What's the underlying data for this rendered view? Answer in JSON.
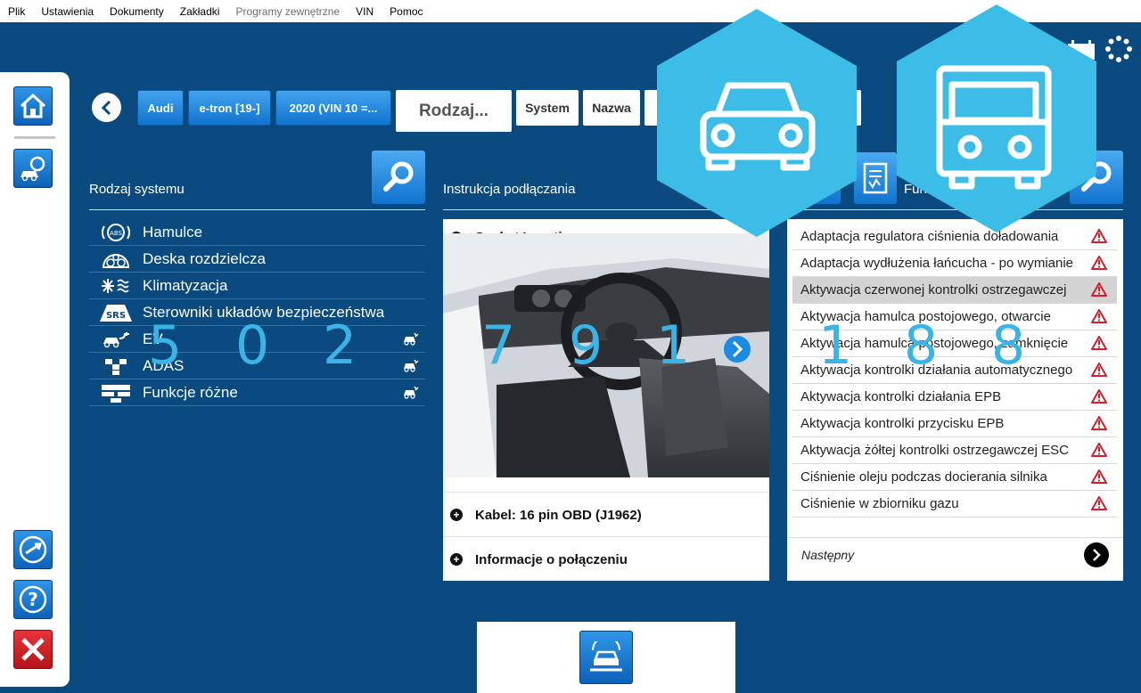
{
  "menu": [
    {
      "label": "Plik",
      "disabled": false
    },
    {
      "label": "Ustawienia",
      "disabled": false
    },
    {
      "label": "Dokumenty",
      "disabled": false
    },
    {
      "label": "Zakładki",
      "disabled": false
    },
    {
      "label": "Programy zewnętrzne",
      "disabled": true
    },
    {
      "label": "VIN",
      "disabled": false
    },
    {
      "label": "Pomoc",
      "disabled": false
    }
  ],
  "breadcrumb": {
    "brand": "Audi",
    "model": "e-tron [19-]",
    "year": "2020 (VIN 10 =...",
    "current": "Rodzaj...",
    "system": "System",
    "name": "Nazwa"
  },
  "left_panel": {
    "title": "Rodzaj systemu",
    "items": [
      {
        "label": "Hamulce",
        "icon": "abs-icon",
        "car": false
      },
      {
        "label": "Deska rozdzielcza",
        "icon": "dashboard-icon",
        "car": false
      },
      {
        "label": "Klimatyzacja",
        "icon": "climate-icon",
        "car": false
      },
      {
        "label": "Sterowniki układów bezpieczeństwa",
        "icon": "srs-icon",
        "car": false
      },
      {
        "label": "EV",
        "icon": "ev-icon",
        "car": true
      },
      {
        "label": "ADAS",
        "icon": "adas-icon",
        "car": true
      },
      {
        "label": "Funkcje różne",
        "icon": "misc-functions-icon",
        "car": true
      }
    ]
  },
  "middle_panel": {
    "title": "Instrukcja podłączania",
    "socket_location": "Socket Location",
    "cable": "Kabel: 16 pin OBD (J1962)",
    "connection_info": "Informacje o połączeniu"
  },
  "right_panel": {
    "title": "Fun",
    "functions": [
      "Adaptacja regulatora ciśnienia doładowania",
      "Adaptacja wydłużenia łańcucha - po wymianie",
      "Aktywacja czerwonej kontrolki ostrzegawczej",
      "Aktywacja hamulca postojowego, otwarcie",
      "Aktywacja hamulca postojowego, zamknięcie",
      "Aktywacja kontrolki działania automatycznego",
      "Aktywacja kontrolki działania EPB",
      "Aktywacja kontrolki przycisku EPB",
      "Aktywacja żółtej kontrolki ostrzegawczej ESC",
      "Ciśnienie oleju podczas docierania silnika",
      "Ciśnienie w zbiorniku gazu"
    ],
    "selected_index": 2,
    "next": "Następny"
  },
  "overlay_numbers": [
    "5",
    "0",
    "2",
    "7",
    "9",
    "1",
    "1",
    "8",
    "8"
  ],
  "colors": {
    "background": "#0b4a7e",
    "accent": "#1a82dc",
    "hex_overlay": "#3bbde8",
    "warning": "#d0202a"
  }
}
